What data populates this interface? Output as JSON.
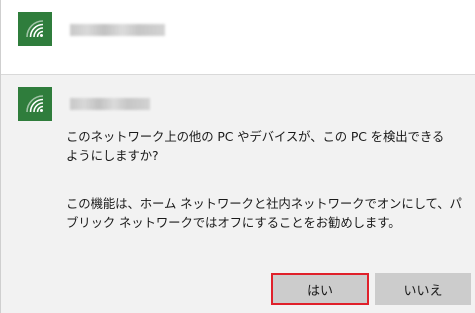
{
  "colors": {
    "wifi_tile": "#2f7d3c",
    "panel_bg": "#f2f2f2",
    "button_bg": "#cccccc",
    "highlight_border": "#e0202a"
  },
  "networks": [
    {
      "icon": "wifi-icon",
      "name_obscured": true
    },
    {
      "icon": "wifi-icon",
      "name_obscured": true,
      "expanded": true
    }
  ],
  "prompt": {
    "message_1": "このネットワーク上の他の PC やデバイスが、この PC を検出できる\nようにしますか?",
    "message_2": "この機能は、ホーム ネットワークと社内ネットワークでオンにして、パ\nブリック ネットワークではオフにすることをお勧めします。",
    "yes_label": "はい",
    "no_label": "いいえ"
  }
}
